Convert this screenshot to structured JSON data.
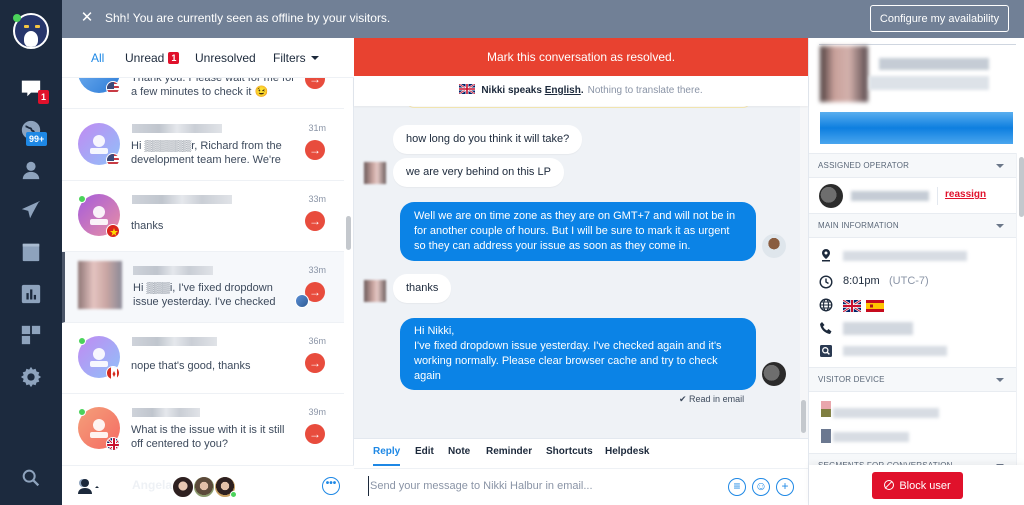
{
  "banner": {
    "message": "Shh! You are currently seen as offline by your visitors.",
    "configure_label": "Configure my availability"
  },
  "nav": {
    "items": [
      {
        "name": "conversations",
        "icon": "chat-bubble-icon",
        "badge": "1",
        "badge_color": "#e0112b"
      },
      {
        "name": "visitors",
        "icon": "globe-icon",
        "badge": "99+",
        "badge_color": "#1e88e5"
      },
      {
        "name": "contacts",
        "icon": "user-icon"
      },
      {
        "name": "campaigns",
        "icon": "paper-plane-icon"
      },
      {
        "name": "helpdesk",
        "icon": "book-icon"
      },
      {
        "name": "analytics",
        "icon": "bar-chart-icon"
      },
      {
        "name": "plugins",
        "icon": "grid-icon"
      },
      {
        "name": "settings",
        "icon": "gear-icon"
      },
      {
        "name": "search",
        "icon": "search-icon"
      }
    ]
  },
  "list": {
    "tabs": [
      {
        "label": "All",
        "active": true
      },
      {
        "label": "Unread",
        "count": "1"
      },
      {
        "label": "Unresolved"
      },
      {
        "label": "Filters"
      }
    ],
    "conversations": [
      {
        "time": "",
        "preview": "Thank you. Please wait for me for a few minutes to check it 😉",
        "flag": "us",
        "online": false
      },
      {
        "time": "31m",
        "preview": "Hi ▒▒▒▒▒▒r, Richard from the development team here. We're",
        "flag": "us",
        "online": false
      },
      {
        "time": "33m",
        "preview": "thanks",
        "flag": "vn",
        "online": true
      },
      {
        "time": "33m",
        "preview": "Hi ▒▒▒i, I've fixed dropdown issue yesterday. I've checked",
        "flag": "",
        "online": false,
        "selected": true
      },
      {
        "time": "36m",
        "preview": "nope that's good, thanks",
        "flag": "ca",
        "online": true
      },
      {
        "time": "39m",
        "preview": "What is the issue with it is it still off centered to you?",
        "flag": "gb",
        "online": true
      }
    ],
    "footer_ghost_name": "Angela"
  },
  "chat": {
    "resolve_label": "Mark this conversation as resolved.",
    "lang": {
      "prefix": "Nikki speaks ",
      "language": "English",
      "suffix": ".",
      "note": "Nothing to translate there."
    },
    "messages": [
      {
        "from": "visitor",
        "text": "how long do you think it will take?"
      },
      {
        "from": "visitor",
        "text": "we are very behind on this LP"
      },
      {
        "from": "operator",
        "text": "Well we are on time zone as they are on GMT+7 and will not be in for another couple of hours. But I will be sure to mark it as urgent so they can address your issue as soon as they come in."
      },
      {
        "from": "visitor",
        "text": "thanks"
      },
      {
        "from": "operator",
        "text": "Hi Nikki,\nI've fixed dropdown issue yesterday. I've checked again and it's working normally. Please clear browser cache and try to check again"
      }
    ],
    "read_status": "✔ Read in email",
    "composer": {
      "tabs": [
        "Reply",
        "Edit",
        "Note",
        "Reminder",
        "Shortcuts",
        "Helpdesk"
      ],
      "active_tab": "Reply",
      "placeholder": "Send your message to Nikki Halbur in email...",
      "value": ""
    }
  },
  "side": {
    "sections": {
      "assigned_operator": "ASSIGNED OPERATOR",
      "main_information": "MAIN INFORMATION",
      "visitor_device": "VISITOR DEVICE",
      "segments": "SEGMENTS FOR CONVERSATION"
    },
    "reassign_label": "reassign",
    "local_time": "8:01pm",
    "timezone": "(UTC-7)",
    "languages": [
      "gb",
      "es"
    ],
    "block_label": "Block user"
  },
  "colors": {
    "accent": "#1e88e5",
    "resolve_red": "#e84230",
    "danger": "#e0112b",
    "nav_bg": "#1c2a3e",
    "banner_bg": "#718096"
  }
}
